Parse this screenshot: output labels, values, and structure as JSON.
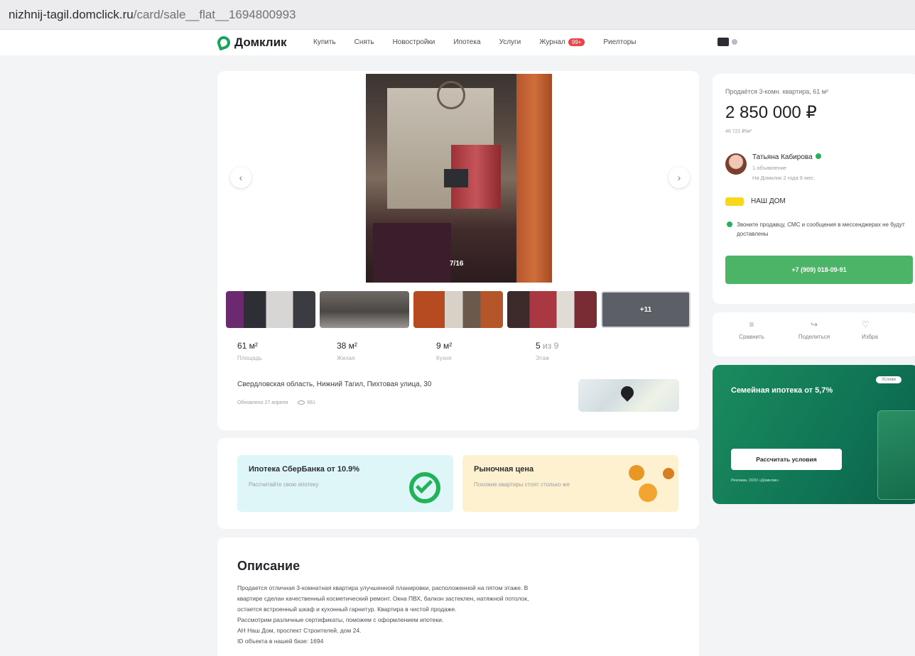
{
  "browser": {
    "url_host": "nizhnij-tagil.domclick.ru",
    "url_path": "/card/sale__flat__1694800993"
  },
  "nav": {
    "logo_text": "Домклик",
    "items": [
      "Купить",
      "Снять",
      "Новостройки",
      "Ипотека",
      "Услуги",
      "Журнал",
      "Риелторы"
    ],
    "journal_badge": "99+"
  },
  "gallery": {
    "counter": "7/16",
    "more_photos": "+11"
  },
  "facts": [
    {
      "value": "61 м²",
      "label": "Площадь"
    },
    {
      "value": "38 м²",
      "label": "Жилая"
    },
    {
      "value": "9 м²",
      "label": "Кухня"
    },
    {
      "value": "5",
      "value_suffix": "из 9",
      "label": "Этаж"
    }
  ],
  "address": "Свердловская область, Нижний Тагил, Пихтовая улица, 30",
  "updated": "Обновлено 27 апреля",
  "views": "661",
  "offers": {
    "sber_title": "Ипотека СберБанка от 10.9%",
    "sber_sub": "Рассчитайте свою ипотеку",
    "market_title": "Рыночная цена",
    "market_sub": "Похожие квартиры стоят столько же"
  },
  "description": {
    "title": "Описание",
    "lines": [
      "Продается отличная 3-комнатная квартира улучшенной планировки, расположенной на пятом этаже. В",
      "квартире сделан качественный косметический ремонт. Окна ПВХ, балкон застеклен, натяжной потолок,",
      "остается встроенный шкаф и кухонный гарнитур. Квартира в чистой продаже.",
      "Рассмотрим различные сертификаты, поможем с оформлением ипотеки.",
      "АН Наш Дом, проспект Строителей, дом 24.",
      "ID объекта в нашей базе: 1694"
    ]
  },
  "listing": {
    "heading": "Продаётся 3-комн. квартира, 61 м²",
    "price": "2 850 000 ₽",
    "price_per_m2": "46 721 ₽/м²",
    "seller_name": "Татьяна Кабирова",
    "seller_ads": "1 объявление",
    "seller_since": "На Домклик 2 года 6 мес.",
    "agency": "НАШ ДОМ",
    "notice": "Звоните продавцу, СМС и сообщения в мессенджерах не будут доставлены",
    "phone": "+7 (909) 018-09-91"
  },
  "actions": {
    "compare": "Сравнить",
    "share": "Поделиться",
    "favorite": "Избра"
  },
  "promo": {
    "title": "Семейная ипотека от 5,7%",
    "tag": "Услови",
    "button": "Рассчитать условия",
    "note": "Реклама. ООО «Домклик»"
  },
  "colors": {
    "accent_green": "#4cb467",
    "promo_green": "#0f7455",
    "page_bg": "#f3f4f6"
  }
}
